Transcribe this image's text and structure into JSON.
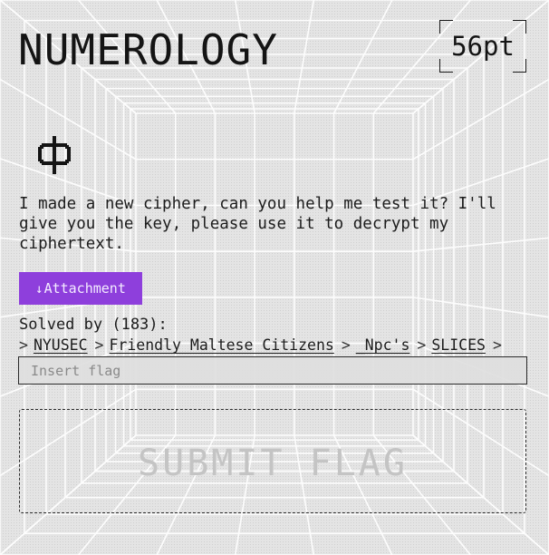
{
  "challenge": {
    "title": "NUMEROLOGY",
    "points": "56pt",
    "category_icon": "phi-icon",
    "description": "I made a new cipher, can you help me test it? I'll give you the key, please use it to decrypt my ciphertext."
  },
  "attachment": {
    "icon": "download-arrow-icon",
    "icon_glyph": "↓",
    "label": "Attachment"
  },
  "solves": {
    "label": "Solved by (183):",
    "separator": ">",
    "teams": [
      "NYUSEC",
      "Friendly Maltese Citizens",
      "_Npc's",
      "SLICES"
    ]
  },
  "flag_form": {
    "placeholder": "Insert flag",
    "submit_label": "SUBMIT FLAG"
  },
  "colors": {
    "accent": "#8e3fdc",
    "background": "#e3e3e3",
    "text": "#1c1c1c"
  }
}
